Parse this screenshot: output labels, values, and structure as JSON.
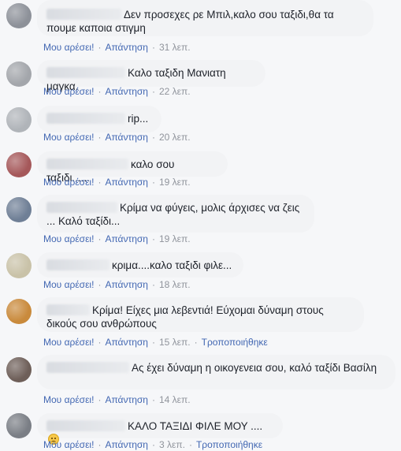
{
  "colors": {
    "bubble_bg": "#f2f3f5",
    "link": "#4267b2",
    "meta": "#90949c",
    "page_bg": "#f6f7f9"
  },
  "comments": [
    {
      "text": "Δεν προσεχες ρε Μπιλ,καλο σου ταξιδι,θα τα πουμε καποια στιγμη",
      "like": "Μου αρέσει!",
      "reply": "Απάντηση",
      "time": "31 λεπ.",
      "edited": ""
    },
    {
      "text": "Καλο ταξιδη Μανιατη μαγκα.",
      "like": "Μου αρέσει!",
      "reply": "Απάντηση",
      "time": "22 λεπ.",
      "edited": ""
    },
    {
      "text": "rip...",
      "like": "Μου αρέσει!",
      "reply": "Απάντηση",
      "time": "20 λεπ.",
      "edited": ""
    },
    {
      "text": "καλο σου ταξιδι......",
      "like": "Μου αρέσει!",
      "reply": "Απάντηση",
      "time": "19 λεπ.",
      "edited": ""
    },
    {
      "text": "Κρίμα να φύγεις, μολις άρχισες να ζεις ... Καλό ταξίδι...",
      "like": "Μου αρέσει!",
      "reply": "Απάντηση",
      "time": "19 λεπ.",
      "edited": ""
    },
    {
      "text": "κριμα....καλο ταξιδι φιλε...",
      "like": "Μου αρέσει!",
      "reply": "Απάντηση",
      "time": "18 λεπ.",
      "edited": ""
    },
    {
      "text": "Κρίμα! Είχες μια λεβεντιά! Εύχομαι δύναμη στους δικούς σου ανθρώπους",
      "like": "Μου αρέσει!",
      "reply": "Απάντηση",
      "time": "15 λεπ.",
      "edited": "Τροποποιήθηκε"
    },
    {
      "text": "Ας έχει δύναμη η οικογενεια σου, καλό ταξίδι Βασίλη",
      "like": "Μου αρέσει!",
      "reply": "Απάντηση",
      "time": "14 λεπ.",
      "edited": ""
    },
    {
      "text": "ΚΑΛΟ ΤΑΞΙΔΙ ΦΙΛΕ ΜΟΥ ....",
      "emoji": "sad-face-emoji",
      "like": "Μου αρέσει!",
      "reply": "Απάντηση",
      "time": "3 λεπ.",
      "edited": "Τροποποιήθηκε"
    }
  ]
}
